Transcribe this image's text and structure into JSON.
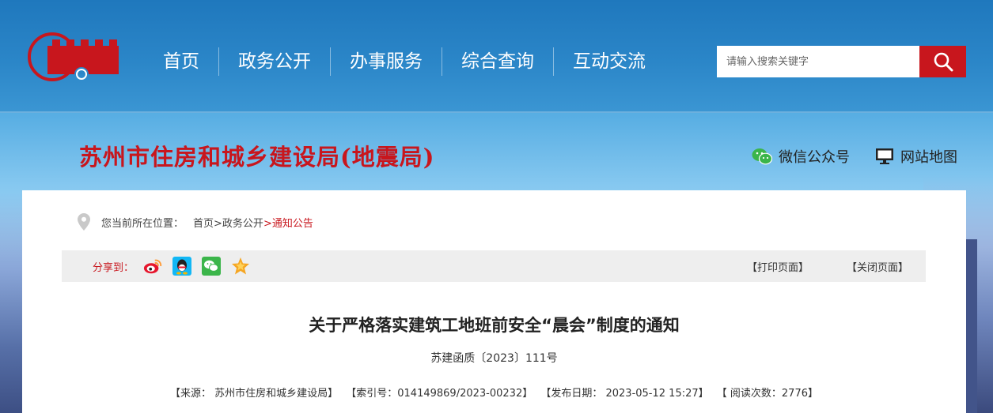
{
  "header": {
    "nav": [
      "首页",
      "政务公开",
      "办事服务",
      "综合查询",
      "互动交流"
    ],
    "search": {
      "placeholder": "请输入搜索关键字"
    }
  },
  "site": {
    "title": "苏州市住房和城乡建设局(地震局)",
    "quick_links": [
      {
        "icon": "wechat-icon",
        "label": "微信公众号"
      },
      {
        "icon": "monitor-icon",
        "label": "网站地图"
      }
    ]
  },
  "breadcrumb": {
    "prefix": "您当前所在位置：",
    "items": [
      "首页",
      ">政务公开",
      ">通知公告"
    ]
  },
  "share": {
    "label": "分享到：",
    "targets": [
      "weibo-icon",
      "qq-icon",
      "wechat-icon",
      "favorite-star-icon"
    ],
    "actions": [
      "【打印页面】",
      "【关闭页面】"
    ]
  },
  "article": {
    "title": "关于严格落实建筑工地班前安全“晨会”制度的通知",
    "doc_number": "苏建函质〔2023〕111号",
    "meta": {
      "source": "【来源： 苏州市住房和城乡建设局】",
      "index": "【索引号：014149869/2023-00232】",
      "date": "【发布日期： 2023-05-12 15:27】",
      "views": "【 阅读次数：2776】"
    }
  },
  "colors": {
    "brand_red": "#c8161d",
    "header_blue": "#2b86c8"
  }
}
